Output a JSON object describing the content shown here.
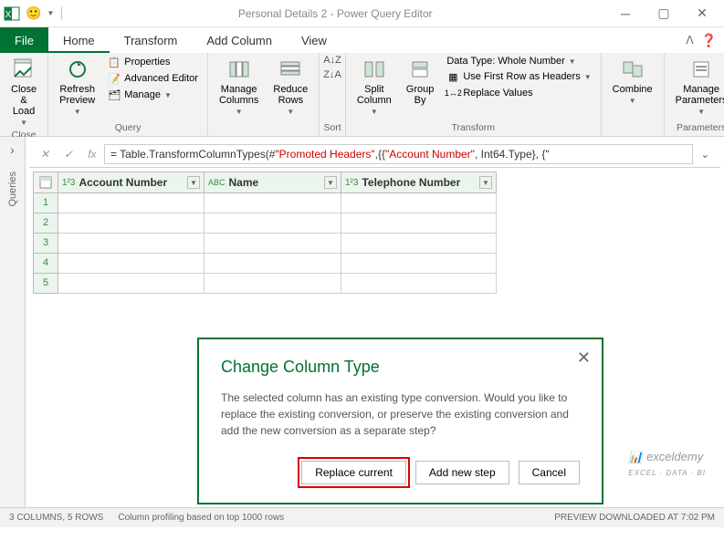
{
  "title": "Personal Details 2 - Power Query Editor",
  "menu": {
    "file": "File",
    "tabs": [
      "Home",
      "Transform",
      "Add Column",
      "View"
    ]
  },
  "ribbon": {
    "close": {
      "label": "Close &\nLoad",
      "group": "Close"
    },
    "query": {
      "refresh": "Refresh\nPreview",
      "properties": "Properties",
      "advanced": "Advanced Editor",
      "manage": "Manage",
      "group": "Query"
    },
    "cols": {
      "manage": "Manage\nColumns",
      "reduce": "Reduce\nRows"
    },
    "sort": "Sort",
    "transform": {
      "split": "Split\nColumn",
      "group": "Group\nBy",
      "dtype": "Data Type: Whole Number",
      "firstrow": "Use First Row as Headers",
      "replace": "Replace Values",
      "group_label": "Transform"
    },
    "combine": {
      "label": "Combine",
      "group": ""
    },
    "params": {
      "label": "Manage\nParameters",
      "group": "Parameters"
    }
  },
  "formula": {
    "prefix": "= Table.TransformColumnTypes(#",
    "str1": "\"Promoted Headers\"",
    "mid": ",{{",
    "str2": "\"Account Number\"",
    "suffix": ", Int64.Type}, {\""
  },
  "side": {
    "queries": "Queries"
  },
  "cols": [
    {
      "type": "1²3",
      "name": "Account Number"
    },
    {
      "type": "ABC",
      "name": "Name"
    },
    {
      "type": "1²3",
      "name": "Telephone Number"
    }
  ],
  "rows": [
    1,
    2,
    3,
    4,
    5
  ],
  "dialog": {
    "title": "Change Column Type",
    "body": "The selected column has an existing type conversion. Would you like to replace the existing conversion, or preserve the existing conversion and add the new conversion as a separate step?",
    "btn1": "Replace current",
    "btn2": "Add new step",
    "btn3": "Cancel"
  },
  "status": {
    "cols": "3 COLUMNS, 5 ROWS",
    "profile": "Column profiling based on top 1000 rows",
    "preview": "PREVIEW DOWNLOADED AT 7:02 PM"
  }
}
